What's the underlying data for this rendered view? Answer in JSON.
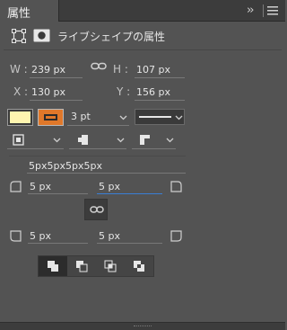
{
  "panel": {
    "tab_title": "属性",
    "layer_title": "ライブシェイプの属性"
  },
  "transform": {
    "w_label": "W :",
    "w_value": "239 px",
    "h_label": "H :",
    "h_value": "107 px",
    "x_label": "X :",
    "x_value": "130 px",
    "y_label": "Y :",
    "y_value": "156 px"
  },
  "appearance": {
    "fill_color": "#fff5b0",
    "stroke_color": "#e0782a",
    "stroke_width": "3 pt"
  },
  "corners": {
    "summary": "5px5px5px5px",
    "top_left": "5 px",
    "top_right": "5 px",
    "bottom_left": "5 px",
    "bottom_right": "5 px"
  }
}
